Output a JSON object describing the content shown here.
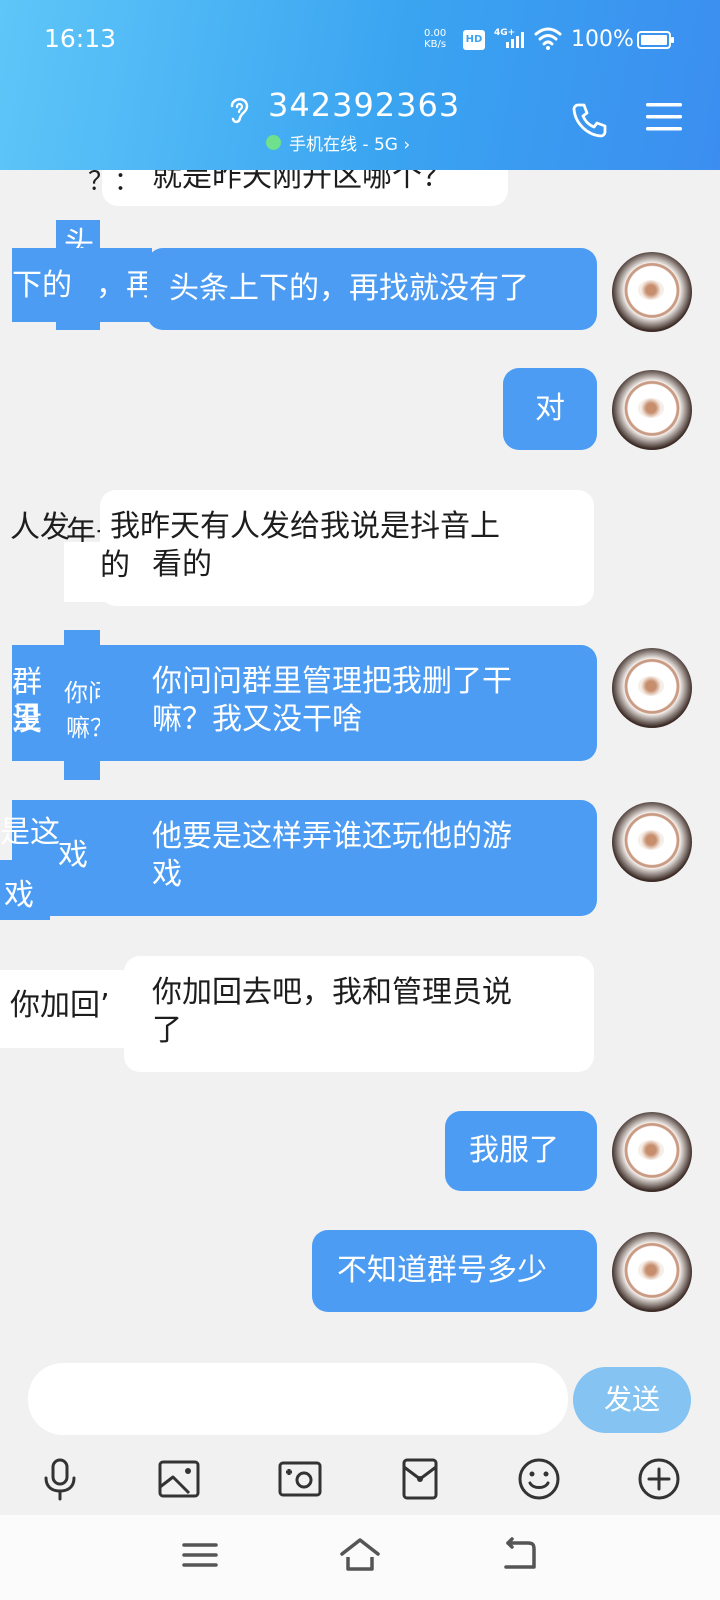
{
  "status_bar": {
    "time": "16:13",
    "net_speed_value": "0.00",
    "net_speed_unit": "KB/s",
    "hd": "HD",
    "network": "4G+",
    "battery": "100%"
  },
  "header": {
    "contact_number": "342392363",
    "online_status": "手机在线 - 5G ›"
  },
  "messages": [
    {
      "side": "left",
      "text": "就是昨天刚开区哪个？",
      "partial": true
    },
    {
      "side": "right",
      "text": "头条上下的，再找就没有了"
    },
    {
      "side": "right",
      "text": "对"
    },
    {
      "side": "left",
      "line1": "我昨天有人发给我说是抖音上",
      "line2": "看的"
    },
    {
      "side": "right",
      "line1": "你问问群里管理把我删了干",
      "line2": "嘛？我又没干啥"
    },
    {
      "side": "right",
      "line1": "他要是这样弄谁还玩他的游",
      "line2": "戏"
    },
    {
      "side": "left",
      "line1": "你加回去吧，我和管理员说",
      "line2": "了"
    },
    {
      "side": "right",
      "text": "我服了"
    },
    {
      "side": "right",
      "text": "不知道群号多少"
    }
  ],
  "glitch_fragments": {
    "f1": "？：",
    "f2": "头",
    "f3": "头",
    "f4": "下的",
    "f5": "，再",
    "f6": "人发",
    "f7": "年子",
    "f8": "的",
    "f9": "群里",
    "f10": "你问",
    "f11": "嘛？",
    "f12": "没",
    "f13": "是这",
    "f14": "戏",
    "f15": "戏",
    "f16": "你加回’"
  },
  "input": {
    "placeholder": "",
    "send_label": "发送"
  },
  "toolbar": [
    "microphone-icon",
    "image-icon",
    "camera-icon",
    "red-packet-icon",
    "emoji-icon",
    "plus-icon"
  ],
  "colors": {
    "header": "#3aa4f1",
    "bubble_right": "#4c9cf4",
    "bubble_left": "#ffffff",
    "send_button": "#84c3f2"
  }
}
